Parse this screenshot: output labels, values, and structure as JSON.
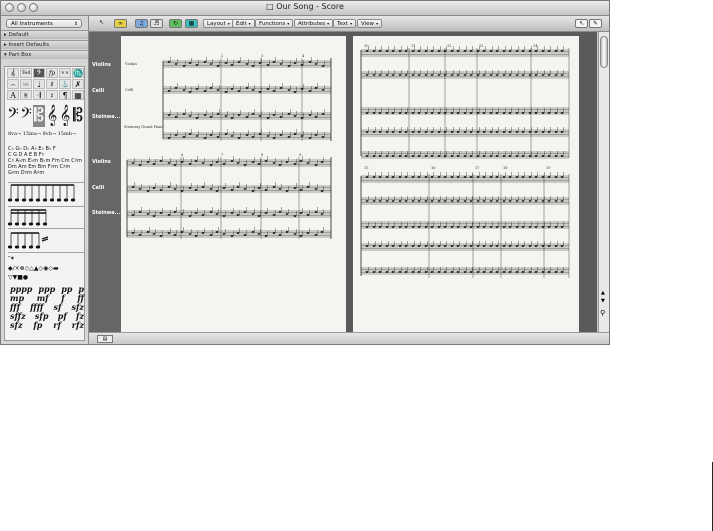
{
  "window": {
    "title": "Our Song - Score"
  },
  "left_panel": {
    "instrument_selector": "All Instruments",
    "sections": [
      "Default",
      "Insert Defaults",
      "Part Box"
    ],
    "part_symbols": [
      "𝄞",
      "Ted",
      "𝄢",
      "fp",
      "××",
      "♏",
      "⌢",
      "♭♭",
      "♩",
      "♯",
      "⚓",
      "✗",
      "A",
      "𝄋",
      "𝄇",
      "𝄽",
      "¶",
      "▦"
    ],
    "clefs": [
      "𝄢",
      "𝄢",
      "𝄡",
      "𝄞",
      "𝄞",
      "𝄡"
    ],
    "octave_marks": "8va¬ 15ma¬  8vb¬ 15mb¬",
    "chords": [
      "C♭ G♭ D♭ A♭ E♭ B♭ F",
      "C  G  D  A  E  B  F♯",
      "C♯  A♭m E♭m B♭m  Fm  Cm C♯m",
      "Dm Am Em Bm F♯m  C♯m",
      "G♯m D♯m A♯m"
    ],
    "misc_row1": "𝄻✶",
    "misc_row2": "◆∕×⊗◇△▲◇◉◇▬",
    "misc_row3": "▽▼■●",
    "dynamics": [
      [
        "pppp",
        "ppp",
        "pp",
        "p"
      ],
      [
        "mp",
        "mf",
        "f",
        "ff"
      ],
      [
        "fff",
        "ffff",
        "sf",
        "sfz"
      ],
      [
        "sffz",
        "sfp",
        "pf",
        "fz"
      ],
      [
        "sfz",
        "fp",
        "rf",
        "rfz"
      ]
    ]
  },
  "toolbar": {
    "icons": [
      "arrow-icon",
      "link-icon",
      "catch-icon",
      "midi-out-icon",
      "flex-icon",
      "content-icon"
    ],
    "menus": [
      "Layout",
      "Edit",
      "Functions",
      "Attributes",
      "Text",
      "View"
    ]
  },
  "score": {
    "track_labels": [
      "Violins",
      "Celli",
      "Steinwa...",
      "Violins",
      "Celli",
      "Steinwa..."
    ],
    "page1_names": [
      "Violins",
      "Celli",
      "Steinway Grand Piano"
    ],
    "page1_top_measures": [
      "1",
      "2",
      "3",
      "4"
    ],
    "page1_bottom_measures": [
      "5",
      "6",
      "7",
      "8",
      "9"
    ],
    "page2_top_measures": [
      "10",
      "11",
      "12",
      "13",
      "14"
    ],
    "page2_bottom_measures": [
      "15",
      "16",
      "17",
      "18",
      "19"
    ]
  },
  "colors": {
    "score_bg": "#5a5a5a",
    "page": "#f5f4f0",
    "panel": "#d6d6d6"
  }
}
